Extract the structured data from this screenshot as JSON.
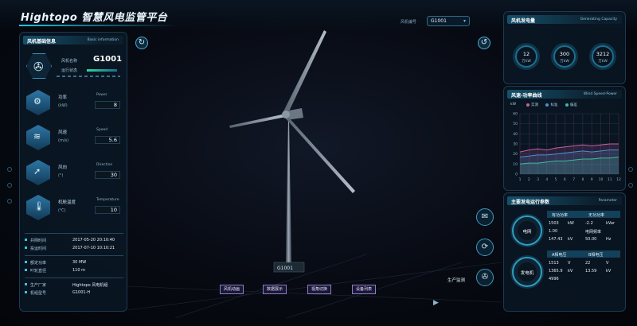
{
  "header": {
    "app_title": "Hightopo 智慧风电监管平台",
    "turbine_select_label": "风机编号",
    "turbine_select_value": "G1001"
  },
  "left_panel": {
    "title": "风机基础信息",
    "title_en": "Basic information",
    "id_label": "风机名称",
    "id_value": "G1001",
    "status_label": "运行状态",
    "metrics": [
      {
        "zh": "功率",
        "unit": "(kW)",
        "en": "Power",
        "value": "8",
        "icon": "power-icon",
        "glyph": "⚙"
      },
      {
        "zh": "风速",
        "unit": "(m/s)",
        "en": "Speed",
        "value": "5.6",
        "icon": "wind-icon",
        "glyph": "≋"
      },
      {
        "zh": "风向",
        "unit": "(°)",
        "en": "Direction",
        "value": "30",
        "icon": "compass-icon",
        "glyph": "➚"
      },
      {
        "zh": "机舱温度",
        "unit": "(℃)",
        "en": "Temperature",
        "value": "10",
        "icon": "thermometer-icon",
        "glyph": "🌡"
      }
    ],
    "info_a": [
      {
        "k": "并网时间",
        "v": "2017-05-20 20:10:40"
      },
      {
        "k": "投运时间",
        "v": "2017-07-10 10:10:21"
      }
    ],
    "info_b": [
      {
        "k": "额定功率",
        "v": "30 MW"
      },
      {
        "k": "叶轮直径",
        "v": "110 m"
      }
    ],
    "info_c": [
      {
        "k": "生产厂家",
        "v": "Hightopo 风电机组"
      },
      {
        "k": "机组型号",
        "v": "G1001-H"
      }
    ]
  },
  "right_panels": {
    "gen_title": "风机发电量",
    "gen_title_en": "Generating Capacity",
    "gauges": [
      {
        "value": "12",
        "unit": "万kW"
      },
      {
        "value": "300",
        "unit": "万kW"
      },
      {
        "value": "3212",
        "unit": "万kW"
      }
    ],
    "curve_title": "风速-功率曲线",
    "curve_title_en": "Wind Speed-Power",
    "curve_unit": "kW",
    "curve_legend": [
      "实测",
      "标准",
      "偏差"
    ],
    "status_title": "主要发电运行参数",
    "status_title_en": "Parameter",
    "rings": [
      "电网",
      "发电机"
    ],
    "table1_head": [
      "有功功率",
      "无功功率"
    ],
    "table1_rows": [
      [
        "1503",
        "kW",
        "-2.2",
        "kVar"
      ],
      [
        "1.00",
        "",
        "电网频率",
        ""
      ],
      [
        "147.43",
        "kV",
        "50.00",
        "Hz"
      ]
    ],
    "table2_head": [
      "A相电压",
      "B相电压"
    ],
    "table2_rows": [
      [
        "1513",
        "V",
        "22",
        "V"
      ],
      [
        "1365.9",
        "kV",
        "13.59",
        "kV"
      ],
      [
        "4996",
        "",
        "",
        ""
      ]
    ]
  },
  "chart_data": {
    "type": "area",
    "x": [
      1,
      2,
      3,
      4,
      5,
      6,
      7,
      8,
      9,
      10,
      11,
      12
    ],
    "ylim": [
      0,
      60
    ],
    "yticks": [
      0,
      10,
      20,
      30,
      40,
      50,
      60
    ],
    "series": [
      {
        "name": "实测",
        "values": [
          22,
          24,
          25,
          24,
          26,
          27,
          28,
          29,
          28,
          29,
          30,
          30
        ],
        "color": "#c45fa4"
      },
      {
        "name": "标准",
        "values": [
          17,
          18,
          19,
          19,
          20,
          21,
          22,
          23,
          22,
          23,
          24,
          24
        ],
        "color": "#4d8fd4"
      },
      {
        "name": "偏差",
        "values": [
          10,
          11,
          11,
          12,
          13,
          13,
          14,
          15,
          15,
          16,
          16,
          17
        ],
        "color": "#3dbd9d"
      }
    ],
    "grid": true
  },
  "center": {
    "production_label": "生产监测",
    "buttons": [
      "风机动画",
      "数据展示",
      "视角切换",
      "设备列表"
    ]
  },
  "colors": {
    "accent": "#1ec8e6",
    "panel_border": "#1b3a52",
    "button_border": "#8d7cc2"
  }
}
